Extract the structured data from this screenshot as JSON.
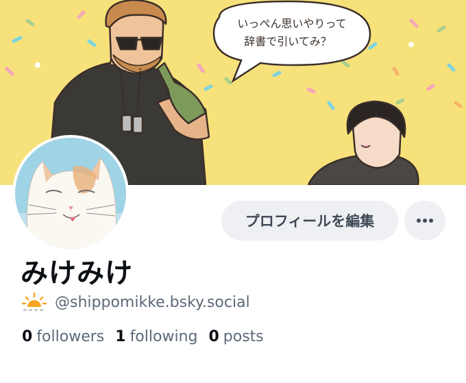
{
  "banner": {
    "speech_line1": "いっぺん思いやりって",
    "speech_line2": "辞書で引いてみ？",
    "colors": {
      "background": "#f7e17b",
      "bubble": "#ffffff",
      "line": "#3a2e28"
    }
  },
  "profile": {
    "display_name": "みけみけ",
    "handle": "@shippomikke.bsky.social",
    "handle_emoji": "sunrise-icon",
    "edit_button_label": "プロフィールを編集",
    "more_icon": "ellipsis-icon"
  },
  "stats": {
    "followers": {
      "count": "0",
      "label": "followers"
    },
    "following": {
      "count": "1",
      "label": "following"
    },
    "posts": {
      "count": "0",
      "label": "posts"
    }
  }
}
